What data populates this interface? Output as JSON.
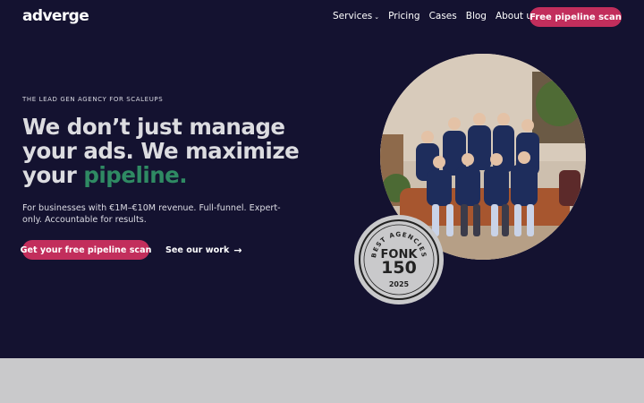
{
  "header": {
    "logo": "adverge",
    "nav": [
      {
        "label": "Services",
        "dropdown": true
      },
      {
        "label": "Pricing",
        "dropdown": false
      },
      {
        "label": "Cases",
        "dropdown": false
      },
      {
        "label": "Blog",
        "dropdown": false
      },
      {
        "label": "About us",
        "dropdown": true
      }
    ],
    "cta_label": "Free pipeline scan"
  },
  "hero": {
    "eyebrow": "THE LEAD GEN AGENCY FOR SCALEUPS",
    "headline_line1": "We don’t just manage",
    "headline_line2": "your ads. We maximize",
    "headline_line3_prefix": "your ",
    "headline_accent": "pipeline.",
    "subtext": "For businesses with €1M–€10M revenue. Full-funnel. Expert-only. Accountable for results.",
    "primary_cta": "Get your free pipeline scan",
    "secondary_cta": "See our work",
    "secondary_cta_icon": "arrow-right-icon"
  },
  "badge": {
    "top_text": "BEST AGENCIES",
    "brand": "FONK",
    "number": "150",
    "year": "2025"
  },
  "colors": {
    "hero_bg": "#141230",
    "accent_pink": "#c22e5c",
    "accent_green": "#2f8a63",
    "headline_text": "#dcdce0",
    "lower_section_bg": "#c9c9cb"
  }
}
